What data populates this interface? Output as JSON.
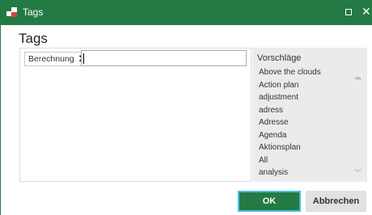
{
  "window": {
    "title": "Tags",
    "accent": "#237a43"
  },
  "dialog": {
    "heading": "Tags"
  },
  "tags": [
    {
      "label": "Berechnung",
      "remove_icon": "close-icon"
    }
  ],
  "input": {
    "value": ""
  },
  "suggestions": {
    "header": "Vorschläge",
    "items": [
      "Above the clouds",
      "Action plan",
      "adjustment",
      "adress",
      "Adresse",
      "Agenda",
      "Aktionsplan",
      "All",
      "analysis"
    ]
  },
  "buttons": {
    "ok": "OK",
    "cancel": "Abbrechen"
  }
}
